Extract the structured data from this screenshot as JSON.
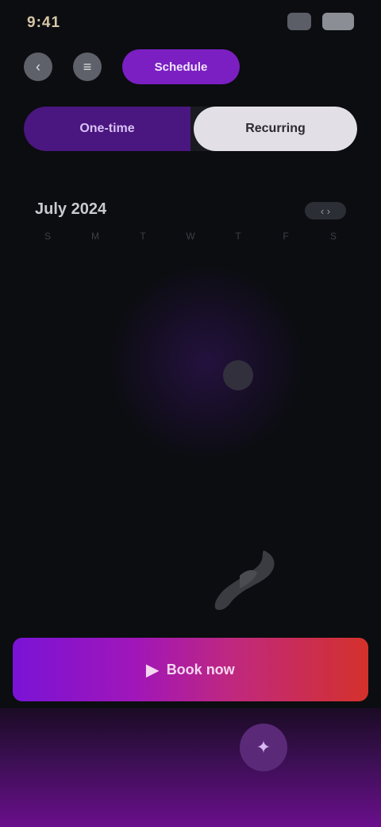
{
  "status_bar": {
    "time": "9:41",
    "icons": [
      "signal-icon",
      "battery-icon"
    ]
  },
  "toolbar": {
    "back_icon": "‹",
    "filter_icon": "≡",
    "active_pill": "Schedule"
  },
  "segmented": {
    "left_label": "One-time",
    "right_label": "Recurring"
  },
  "calendar": {
    "month_label": "July 2024",
    "nav_label": "‹ ›",
    "weekdays": [
      "S",
      "M",
      "T",
      "W",
      "T",
      "F",
      "S"
    ],
    "days": [
      "",
      "",
      "",
      "",
      "",
      "",
      "",
      "",
      "",
      "",
      "",
      "",
      "",
      "",
      "",
      "",
      "",
      "",
      "",
      "",
      "",
      "",
      "",
      "",
      "",
      "",
      "",
      "",
      "",
      "",
      "",
      "",
      "",
      "",
      ""
    ],
    "selected_index": 18
  },
  "cta": {
    "label": "Book now",
    "icon": "▶"
  },
  "bottom": {
    "bubble_icon": "✦"
  },
  "colors": {
    "accent": "#7b1fc2",
    "cta_start": "#7a13d6",
    "cta_end": "#d4312b",
    "background": "#0b0d10"
  }
}
